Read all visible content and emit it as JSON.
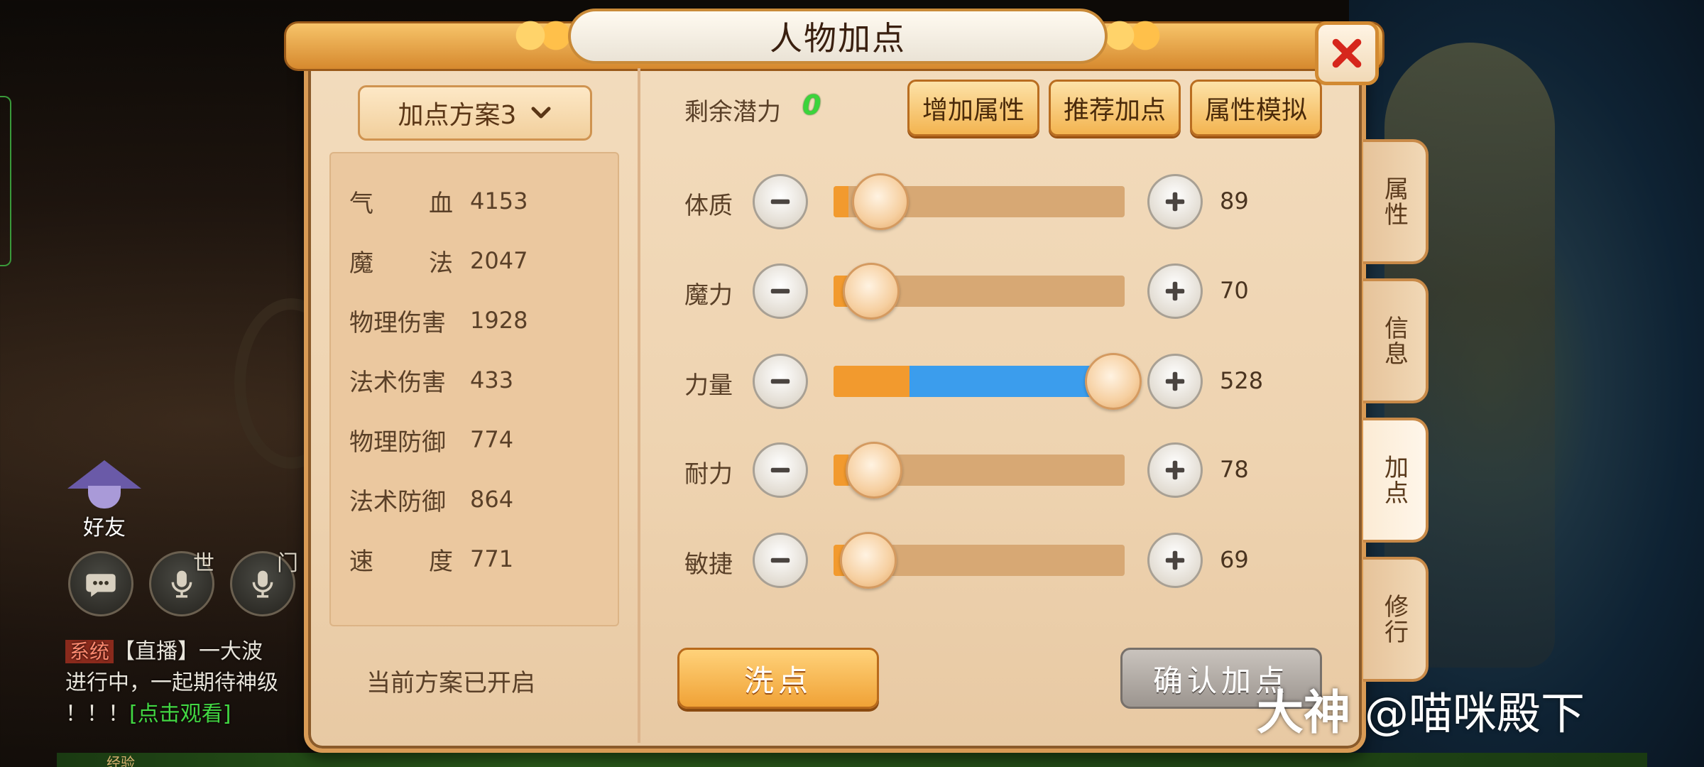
{
  "window": {
    "title": "人物加点",
    "close_icon": "close-icon"
  },
  "plan_selector": {
    "label": "加点方案3",
    "icon": "chevron-down-icon"
  },
  "stats": [
    {
      "name": "气",
      "name2": "血",
      "value": "4153"
    },
    {
      "name": "魔",
      "name2": "法",
      "value": "2047"
    },
    {
      "name": "物理伤害",
      "value": "1928"
    },
    {
      "name": "法术伤害",
      "value": "433"
    },
    {
      "name": "物理防御",
      "value": "774"
    },
    {
      "name": "法术防御",
      "value": "864"
    },
    {
      "name": "速",
      "name2": "度",
      "value": "771"
    }
  ],
  "plan_status": "当前方案已开启",
  "potential": {
    "label": "剩余潜力",
    "value": "0"
  },
  "top_buttons": [
    "增加属性",
    "推荐加点",
    "属性模拟"
  ],
  "attributes": [
    {
      "label": "体质",
      "value": "89",
      "base_fraction": 0.05,
      "added_fraction": 0.0,
      "knob_fraction": 0.16
    },
    {
      "label": "魔力",
      "value": "70",
      "base_fraction": 0.05,
      "added_fraction": 0.0,
      "knob_fraction": 0.13
    },
    {
      "label": "力量",
      "value": "528",
      "base_fraction": 0.26,
      "added_fraction": 0.66,
      "knob_fraction": 0.96
    },
    {
      "label": "耐力",
      "value": "78",
      "base_fraction": 0.05,
      "added_fraction": 0.0,
      "knob_fraction": 0.14
    },
    {
      "label": "敏捷",
      "value": "69",
      "base_fraction": 0.05,
      "added_fraction": 0.0,
      "knob_fraction": 0.12
    }
  ],
  "bottom_buttons": {
    "wash": "洗点",
    "confirm": "确认加点"
  },
  "side_tabs": [
    {
      "label": "属性",
      "active": false
    },
    {
      "label": "信息",
      "active": false
    },
    {
      "label": "加点",
      "active": true
    },
    {
      "label": "修行",
      "active": false
    }
  ],
  "hud": {
    "friend_label": "好友",
    "world_tag": "世",
    "door_tag": "门",
    "chat": {
      "channel": "系统",
      "text1": "【直播】一大波",
      "text2": "进行中，一起期待神级",
      "text3": "！！！",
      "link": "[点击观看]"
    },
    "exp_label": "经验"
  },
  "watermark": {
    "brand": "大神",
    "handle": "@喵咪殿下"
  },
  "colors": {
    "accent_orange": "#f29a2e",
    "added_blue": "#3b9ded",
    "potential_green": "#3bd43b",
    "frame": "#d99b55"
  }
}
